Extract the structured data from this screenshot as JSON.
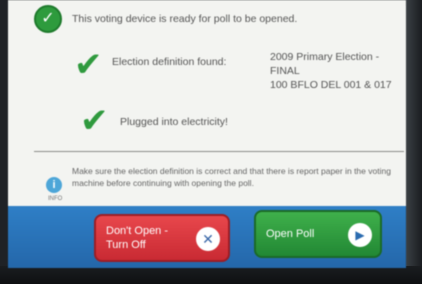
{
  "status": {
    "header_text": "This voting device is ready for poll to be opened."
  },
  "checks": [
    {
      "label": "Election definition found:",
      "value_lines": [
        "2009 Primary Election -",
        "FINAL",
        "100 BFLO DEL 001 & 017"
      ]
    },
    {
      "label": "Plugged into electricity!"
    }
  ],
  "info": {
    "text": "Make sure the election definition is correct and that there is report paper in the voting machine before continuing with opening the poll.",
    "tag": "INFO"
  },
  "buttons": {
    "dont_open_line1": "Don't Open -",
    "dont_open_line2": "Turn Off",
    "open_poll": "Open Poll"
  },
  "colors": {
    "green": "#2f9a3e",
    "red": "#d5343c",
    "blue_bar": "#2a74ba"
  }
}
